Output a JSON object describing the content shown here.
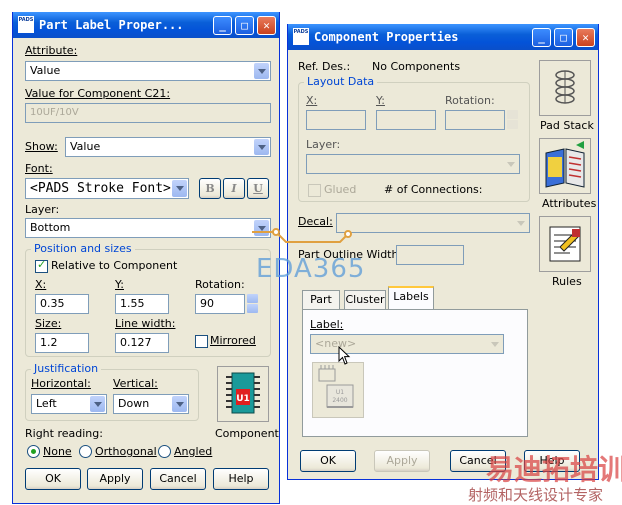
{
  "left_window": {
    "title": "Part Label Proper...",
    "app_icon_text": "PADS",
    "attribute_label": "Attribute:",
    "attribute_value": "Value",
    "value_for_label": "Value for Component C21:",
    "value_for_value": "10UF/10V",
    "show_label": "Show:",
    "show_value": "Value",
    "font_label": "Font:",
    "font_value": "<PADS Stroke Font>",
    "bold_label": "B",
    "italic_label": "I",
    "underline_label": "U",
    "layer_label": "Layer:",
    "layer_value": "Bottom",
    "position_group_title": "Position and sizes",
    "relative_label": "Relative to Component",
    "x_label": "X:",
    "x_value": "0.35",
    "y_label": "Y:",
    "y_value": "1.55",
    "rotation_label": "Rotation:",
    "rotation_value": "90",
    "size_label": "Size:",
    "size_value": "1.2",
    "line_width_label": "Line width:",
    "line_width_value": "0.127",
    "mirrored_label": "Mirrored",
    "justification_title": "Justification",
    "horizontal_label": "Horizontal:",
    "horizontal_value": "Left",
    "vertical_label": "Vertical:",
    "vertical_value": "Down",
    "component_label": "Component",
    "right_reading_label": "Right reading:",
    "radio_none": "None",
    "radio_orthogonal": "Orthogonal",
    "radio_angled": "Angled",
    "ok_label": "OK",
    "apply_label": "Apply",
    "cancel_label": "Cancel",
    "help_label": "Help"
  },
  "right_window": {
    "title": "Component Properties",
    "app_icon_text": "PADS",
    "ref_des_label": "Ref. Des.:",
    "ref_des_value": "No Components",
    "layout_data_title": "Layout Data",
    "x_label": "X:",
    "y_label": "Y:",
    "rotation_label": "Rotation:",
    "layer_label": "Layer:",
    "glued_label": "Glued",
    "connections_label": "# of Connections:",
    "decal_label": "Decal:",
    "outline_width_label": "Part Outline Width:",
    "tabs": [
      "Part",
      "Cluster",
      "Labels"
    ],
    "label_field_label": "Label:",
    "label_placeholder": "<new>",
    "pad_stack_label": "Pad Stack",
    "attributes_label": "Attributes",
    "rules_label": "Rules",
    "ok_label": "OK",
    "apply_label": "Apply",
    "cancel_label": "Cancel",
    "help_label": "Help"
  },
  "watermarks": {
    "eda365": "EDA365",
    "cn_title": "易迪拓培训",
    "cn_subtitle": "射频和天线设计专家"
  },
  "colors": {
    "titlebar": "#0a5fd8",
    "group_title": "#0046d5",
    "dialog_bg": "#ece9d8",
    "watermark_blue": "#5a9bd8",
    "watermark_red": "#d94040"
  }
}
